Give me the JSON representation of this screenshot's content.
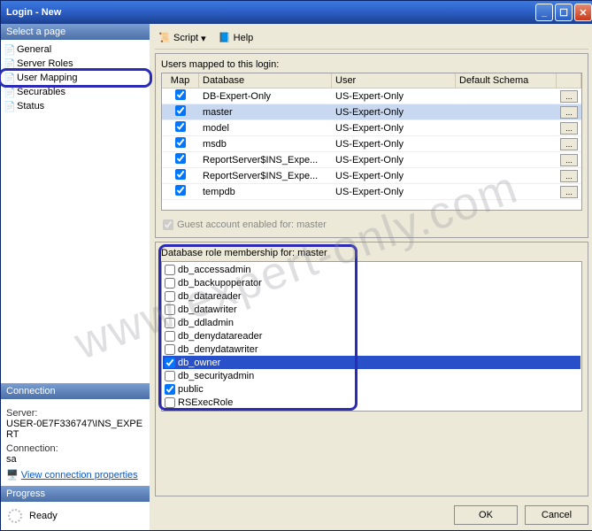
{
  "window": {
    "title": "Login - New"
  },
  "toolbar": {
    "script": "Script",
    "help": "Help"
  },
  "sidebar": {
    "select_page": "Select a page",
    "items": [
      {
        "label": "General"
      },
      {
        "label": "Server Roles"
      },
      {
        "label": "User Mapping"
      },
      {
        "label": "Securables"
      },
      {
        "label": "Status"
      }
    ],
    "connection_head": "Connection",
    "server_label": "Server:",
    "server_value": "USER-0E7F336747\\INS_EXPERT",
    "conn_label": "Connection:",
    "conn_value": "sa",
    "view_props": "View connection properties",
    "progress_head": "Progress",
    "ready": "Ready"
  },
  "mapping": {
    "title": "Users mapped to this login:",
    "headers": {
      "map": "Map",
      "database": "Database",
      "user": "User",
      "schema": "Default Schema"
    },
    "rows": [
      {
        "checked": true,
        "db": "DB-Expert-Only",
        "user": "US-Expert-Only",
        "selected": false
      },
      {
        "checked": true,
        "db": "master",
        "user": "US-Expert-Only",
        "selected": true
      },
      {
        "checked": true,
        "db": "model",
        "user": "US-Expert-Only",
        "selected": false
      },
      {
        "checked": true,
        "db": "msdb",
        "user": "US-Expert-Only",
        "selected": false
      },
      {
        "checked": true,
        "db": "ReportServer$INS_Expe...",
        "user": "US-Expert-Only",
        "selected": false
      },
      {
        "checked": true,
        "db": "ReportServer$INS_Expe...",
        "user": "US-Expert-Only",
        "selected": false
      },
      {
        "checked": true,
        "db": "tempdb",
        "user": "US-Expert-Only",
        "selected": false
      }
    ],
    "guest": "Guest account enabled for: master"
  },
  "roles": {
    "title": "Database role membership for: master",
    "items": [
      {
        "label": "db_accessadmin",
        "checked": false
      },
      {
        "label": "db_backupoperator",
        "checked": false
      },
      {
        "label": "db_datareader",
        "checked": false
      },
      {
        "label": "db_datawriter",
        "checked": false
      },
      {
        "label": "db_ddladmin",
        "checked": false
      },
      {
        "label": "db_denydatareader",
        "checked": false
      },
      {
        "label": "db_denydatawriter",
        "checked": false
      },
      {
        "label": "db_owner",
        "checked": true,
        "selected": true
      },
      {
        "label": "db_securityadmin",
        "checked": false
      },
      {
        "label": "public",
        "checked": true
      },
      {
        "label": "RSExecRole",
        "checked": false
      }
    ]
  },
  "footer": {
    "ok": "OK",
    "cancel": "Cancel"
  },
  "watermark": "www.expert-only.com"
}
